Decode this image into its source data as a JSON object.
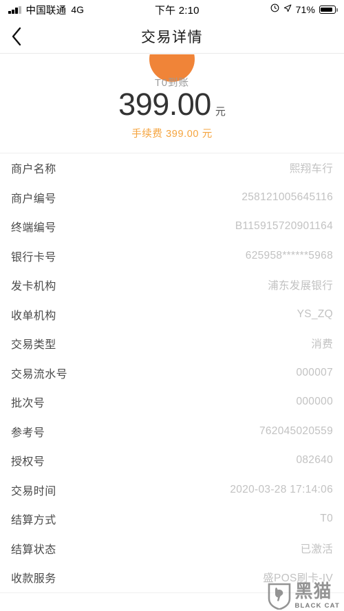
{
  "status_bar": {
    "carrier": "中国联通",
    "network": "4G",
    "time": "下午 2:10",
    "battery_percent": "71%",
    "icons": [
      "signal-bars-icon",
      "alarm-clock-icon",
      "location-arrow-icon",
      "battery-icon"
    ]
  },
  "nav": {
    "back_icon": "chevron-left-icon",
    "title": "交易详情"
  },
  "summary": {
    "arrive_label": "T0到账",
    "amount": "399.00",
    "amount_unit": "元",
    "fee_text": "手续费 399.00 元",
    "accent_color": "#f5a33c",
    "circle_color": "#f08438"
  },
  "details": {
    "rows": [
      {
        "label": "商户名称",
        "value": "熙翔车行"
      },
      {
        "label": "商户编号",
        "value": "258121005645116"
      },
      {
        "label": "终端编号",
        "value": "B115915720901164"
      },
      {
        "label": "银行卡号",
        "value": "625958******5968"
      },
      {
        "label": "发卡机构",
        "value": "浦东发展银行"
      },
      {
        "label": "收单机构",
        "value": "YS_ZQ"
      },
      {
        "label": "交易类型",
        "value": "消费"
      },
      {
        "label": "交易流水号",
        "value": "000007"
      },
      {
        "label": "批次号",
        "value": "000000"
      },
      {
        "label": "参考号",
        "value": "762045020559"
      },
      {
        "label": "授权号",
        "value": "082640"
      },
      {
        "label": "交易时间",
        "value": "2020-03-28 17:14:06"
      },
      {
        "label": "结算方式",
        "value": "T0"
      },
      {
        "label": "结算状态",
        "value": "已激活"
      },
      {
        "label": "收款服务",
        "value": "盛POS刷卡-IV"
      }
    ]
  },
  "watermark": {
    "cn": "黑猫",
    "en": "BLACK CAT",
    "icon": "cat-shield-logo-icon"
  }
}
